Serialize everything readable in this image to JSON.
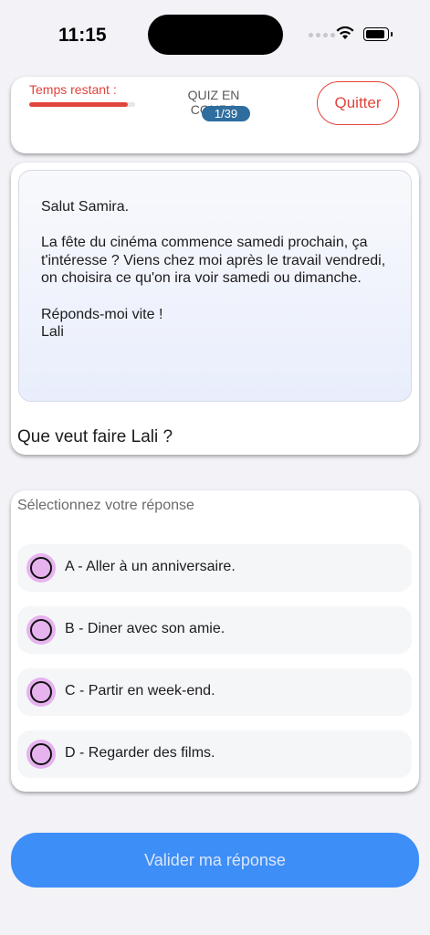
{
  "status_bar": {
    "time": "11:15"
  },
  "header": {
    "timer_label": "Temps restant :",
    "timer_remaining_fraction": 0.93,
    "status_label": "QUIZ EN COURS",
    "progress": "1/39",
    "quit_label": "Quitter"
  },
  "question": {
    "passage": [
      "Salut Samira.",
      "La fête du cinéma commence samedi prochain, ça t'intéresse ? Viens chez moi après le travail vendredi, on choisira ce qu'on ira voir samedi ou dimanche.",
      "Réponds-moi vite !",
      "Lali"
    ],
    "prompt": "Que veut faire Lali ?"
  },
  "answers": {
    "prompt": "Sélectionnez votre réponse",
    "options": [
      {
        "label": "A - Aller à un anniversaire."
      },
      {
        "label": "B - Diner avec son amie."
      },
      {
        "label": "C - Partir en week-end."
      },
      {
        "label": "D - Regarder des films."
      }
    ]
  },
  "submit_label": "Valider ma réponse",
  "colors": {
    "accent_red": "#e0443c",
    "primary_blue": "#3e8ef7",
    "badge_blue": "#2f6d9e",
    "radio_fill": "#e6b3ef"
  }
}
